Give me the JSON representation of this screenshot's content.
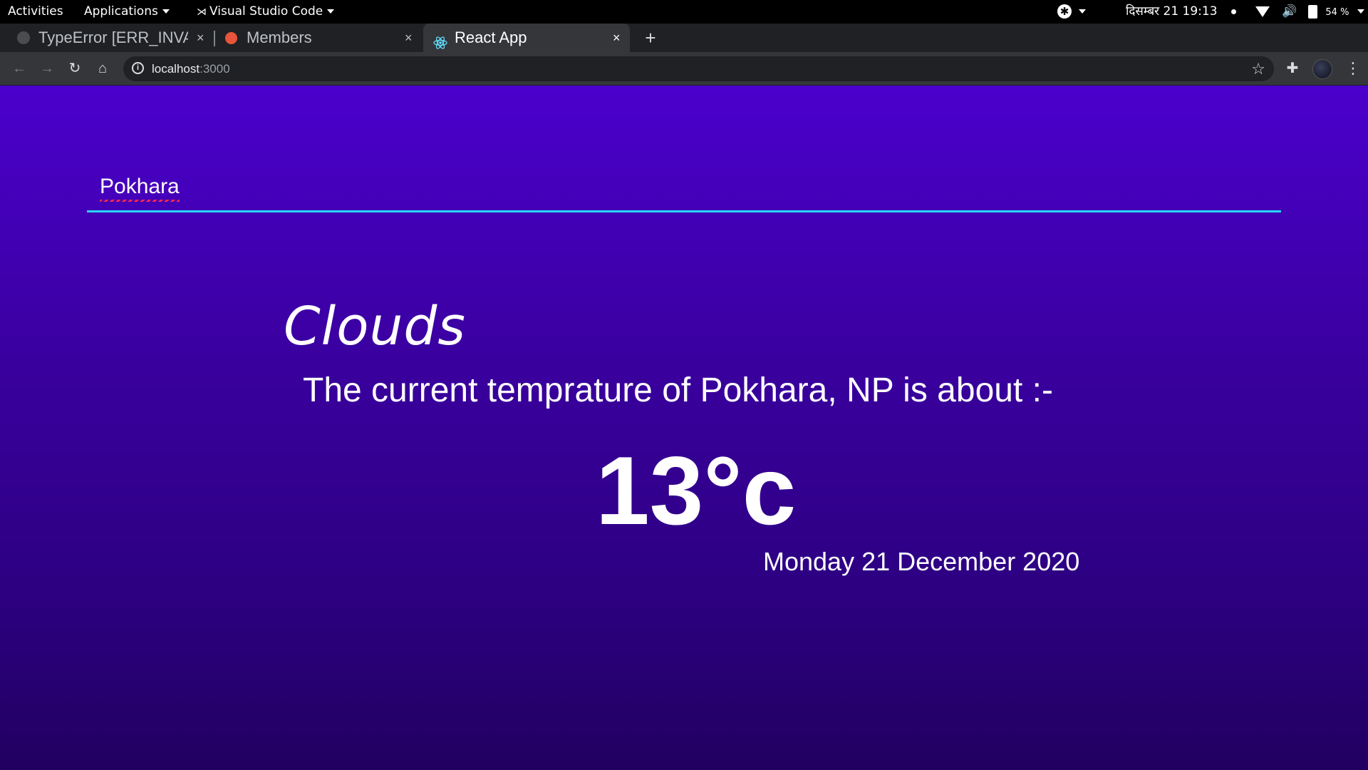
{
  "topbar": {
    "activities": "Activities",
    "applications": "Applications",
    "app_name": "Visual Studio Code",
    "clock": "दिसम्बर 21  19:13",
    "battery": "54 %"
  },
  "tabs": [
    {
      "title": "TypeError [ERR_INVALID",
      "close": "×"
    },
    {
      "title": "Members",
      "close": "×"
    },
    {
      "title": "React App",
      "close": "×"
    }
  ],
  "new_tab_label": "+",
  "address": {
    "host": "localhost",
    "port": ":3000"
  },
  "page": {
    "search": {
      "value": "Pokhara"
    },
    "weather_main": "Clouds",
    "temperature_text": "The current temprature of Pokhara, NP is about :-",
    "temperature_value": "13°c",
    "date": "Monday 21 December 2020"
  },
  "colors": {
    "page_top": "#4b00cc",
    "page_bottom": "#210060",
    "search_underline": "#2ad4f5",
    "spell_underline": "#ff2a4f"
  }
}
